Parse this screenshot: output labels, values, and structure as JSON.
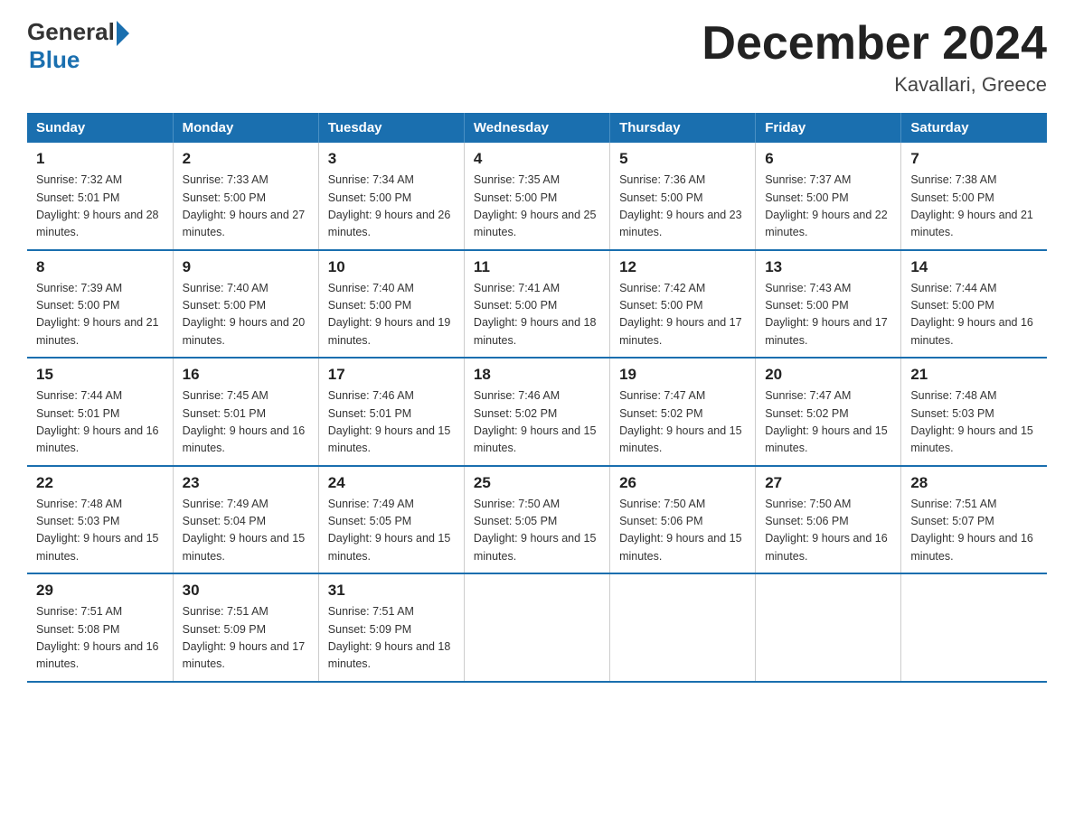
{
  "logo": {
    "general": "General",
    "blue": "Blue"
  },
  "title": "December 2024",
  "subtitle": "Kavallari, Greece",
  "days_of_week": [
    "Sunday",
    "Monday",
    "Tuesday",
    "Wednesday",
    "Thursday",
    "Friday",
    "Saturday"
  ],
  "weeks": [
    [
      {
        "day": "1",
        "sunrise": "7:32 AM",
        "sunset": "5:01 PM",
        "daylight": "9 hours and 28 minutes."
      },
      {
        "day": "2",
        "sunrise": "7:33 AM",
        "sunset": "5:00 PM",
        "daylight": "9 hours and 27 minutes."
      },
      {
        "day": "3",
        "sunrise": "7:34 AM",
        "sunset": "5:00 PM",
        "daylight": "9 hours and 26 minutes."
      },
      {
        "day": "4",
        "sunrise": "7:35 AM",
        "sunset": "5:00 PM",
        "daylight": "9 hours and 25 minutes."
      },
      {
        "day": "5",
        "sunrise": "7:36 AM",
        "sunset": "5:00 PM",
        "daylight": "9 hours and 23 minutes."
      },
      {
        "day": "6",
        "sunrise": "7:37 AM",
        "sunset": "5:00 PM",
        "daylight": "9 hours and 22 minutes."
      },
      {
        "day": "7",
        "sunrise": "7:38 AM",
        "sunset": "5:00 PM",
        "daylight": "9 hours and 21 minutes."
      }
    ],
    [
      {
        "day": "8",
        "sunrise": "7:39 AM",
        "sunset": "5:00 PM",
        "daylight": "9 hours and 21 minutes."
      },
      {
        "day": "9",
        "sunrise": "7:40 AM",
        "sunset": "5:00 PM",
        "daylight": "9 hours and 20 minutes."
      },
      {
        "day": "10",
        "sunrise": "7:40 AM",
        "sunset": "5:00 PM",
        "daylight": "9 hours and 19 minutes."
      },
      {
        "day": "11",
        "sunrise": "7:41 AM",
        "sunset": "5:00 PM",
        "daylight": "9 hours and 18 minutes."
      },
      {
        "day": "12",
        "sunrise": "7:42 AM",
        "sunset": "5:00 PM",
        "daylight": "9 hours and 17 minutes."
      },
      {
        "day": "13",
        "sunrise": "7:43 AM",
        "sunset": "5:00 PM",
        "daylight": "9 hours and 17 minutes."
      },
      {
        "day": "14",
        "sunrise": "7:44 AM",
        "sunset": "5:00 PM",
        "daylight": "9 hours and 16 minutes."
      }
    ],
    [
      {
        "day": "15",
        "sunrise": "7:44 AM",
        "sunset": "5:01 PM",
        "daylight": "9 hours and 16 minutes."
      },
      {
        "day": "16",
        "sunrise": "7:45 AM",
        "sunset": "5:01 PM",
        "daylight": "9 hours and 16 minutes."
      },
      {
        "day": "17",
        "sunrise": "7:46 AM",
        "sunset": "5:01 PM",
        "daylight": "9 hours and 15 minutes."
      },
      {
        "day": "18",
        "sunrise": "7:46 AM",
        "sunset": "5:02 PM",
        "daylight": "9 hours and 15 minutes."
      },
      {
        "day": "19",
        "sunrise": "7:47 AM",
        "sunset": "5:02 PM",
        "daylight": "9 hours and 15 minutes."
      },
      {
        "day": "20",
        "sunrise": "7:47 AM",
        "sunset": "5:02 PM",
        "daylight": "9 hours and 15 minutes."
      },
      {
        "day": "21",
        "sunrise": "7:48 AM",
        "sunset": "5:03 PM",
        "daylight": "9 hours and 15 minutes."
      }
    ],
    [
      {
        "day": "22",
        "sunrise": "7:48 AM",
        "sunset": "5:03 PM",
        "daylight": "9 hours and 15 minutes."
      },
      {
        "day": "23",
        "sunrise": "7:49 AM",
        "sunset": "5:04 PM",
        "daylight": "9 hours and 15 minutes."
      },
      {
        "day": "24",
        "sunrise": "7:49 AM",
        "sunset": "5:05 PM",
        "daylight": "9 hours and 15 minutes."
      },
      {
        "day": "25",
        "sunrise": "7:50 AM",
        "sunset": "5:05 PM",
        "daylight": "9 hours and 15 minutes."
      },
      {
        "day": "26",
        "sunrise": "7:50 AM",
        "sunset": "5:06 PM",
        "daylight": "9 hours and 15 minutes."
      },
      {
        "day": "27",
        "sunrise": "7:50 AM",
        "sunset": "5:06 PM",
        "daylight": "9 hours and 16 minutes."
      },
      {
        "day": "28",
        "sunrise": "7:51 AM",
        "sunset": "5:07 PM",
        "daylight": "9 hours and 16 minutes."
      }
    ],
    [
      {
        "day": "29",
        "sunrise": "7:51 AM",
        "sunset": "5:08 PM",
        "daylight": "9 hours and 16 minutes."
      },
      {
        "day": "30",
        "sunrise": "7:51 AM",
        "sunset": "5:09 PM",
        "daylight": "9 hours and 17 minutes."
      },
      {
        "day": "31",
        "sunrise": "7:51 AM",
        "sunset": "5:09 PM",
        "daylight": "9 hours and 18 minutes."
      },
      null,
      null,
      null,
      null
    ]
  ]
}
